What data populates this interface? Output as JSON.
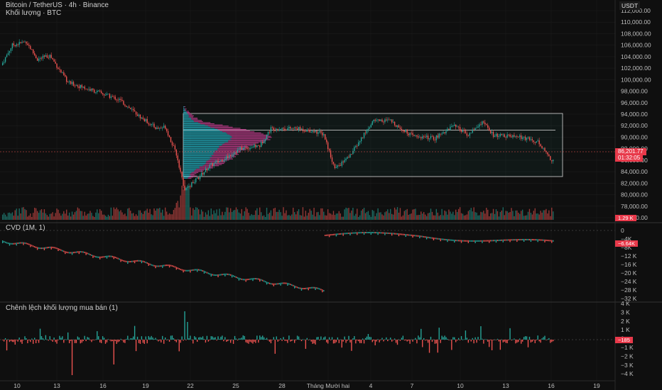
{
  "header": {
    "symbol_line": "Bitcoin / TetherUS · 4h · Binance",
    "volume_line": "Khối lượng · BTC"
  },
  "axis": {
    "currency": "USDT",
    "price_ticks": [
      "112,000.00",
      "110,000.00",
      "108,000.00",
      "106,000.00",
      "104,000.00",
      "102,000.00",
      "100,000.00",
      "98,000.00",
      "96,000.00",
      "94,000.00",
      "92,000.00",
      "90,000.00",
      "88,000.00",
      "86,000.00",
      "84,000.00",
      "82,000.00",
      "80,000.00",
      "78,000.00",
      "76,000.00"
    ],
    "price_values": [
      112000,
      110000,
      108000,
      106000,
      104000,
      102000,
      100000,
      98000,
      96000,
      94000,
      92000,
      90000,
      88000,
      86000,
      84000,
      82000,
      80000,
      78000,
      76000
    ],
    "last_price": "86,201.77",
    "countdown": "01:32:05",
    "volume_badge": "1.29 K",
    "date_labels": [
      "10",
      "13",
      "16",
      "19",
      "22",
      "25",
      "28",
      "Tháng Mười hai",
      "4",
      "7",
      "10",
      "13",
      "16",
      "19"
    ]
  },
  "cvd": {
    "title": "CVD (1M, 1)",
    "ticks": [
      "0",
      "−4K",
      "−8K",
      "−12 K",
      "−16 K",
      "−20 K",
      "−24 K",
      "−28 K",
      "−32 K"
    ],
    "badge": "−6.64K"
  },
  "delta": {
    "title": "Chênh lệch khối lượng mua bán (1)",
    "ticks": [
      "4 K",
      "3 K",
      "2 K",
      "1 K",
      "0",
      "−1 K",
      "−2 K",
      "−3 K",
      "−4 K"
    ],
    "badge": "−185"
  },
  "colors": {
    "up": "#26a69a",
    "down": "#ef5350",
    "background": "#0f0f0f",
    "profile_up": "#26c6da",
    "profile_down": "#e040a0"
  }
}
